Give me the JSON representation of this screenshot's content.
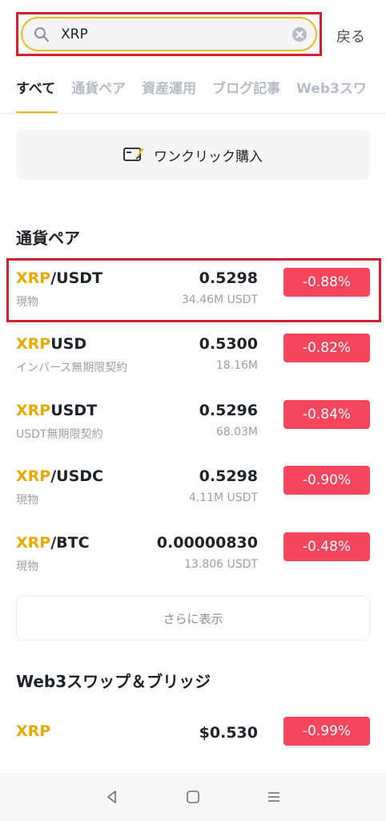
{
  "search": {
    "value": "XRP",
    "back_label": "戻る"
  },
  "tabs": [
    {
      "label": "すべて",
      "active": true
    },
    {
      "label": "通貨ペア"
    },
    {
      "label": "資産運用"
    },
    {
      "label": "ブログ記事"
    },
    {
      "label": "Web3スワ"
    }
  ],
  "oneclick": {
    "label": "ワンクリック購入"
  },
  "sections": {
    "pairs_title": "通貨ペア",
    "web3_title": "Web3スワップ＆ブリッジ"
  },
  "pairs": [
    {
      "base": "XRP",
      "quote": "/USDT",
      "sub": "現物",
      "price": "0.5298",
      "volume": "34.46M USDT",
      "change": "-0.88%"
    },
    {
      "base": "XRP",
      "quote": "USD",
      "sub": "インバース無期限契約",
      "price": "0.5300",
      "volume": "18.16M",
      "change": "-0.82%"
    },
    {
      "base": "XRP",
      "quote": "USDT",
      "sub": "USDT無期限契約",
      "price": "0.5296",
      "volume": "68.03M",
      "change": "-0.84%"
    },
    {
      "base": "XRP",
      "quote": "/USDC",
      "sub": "現物",
      "price": "0.5298",
      "volume": "4.11M USDT",
      "change": "-0.90%"
    },
    {
      "base": "XRP",
      "quote": "/BTC",
      "sub": "現物",
      "price": "0.00000830",
      "volume": "13.806 USDT",
      "change": "-0.48%"
    }
  ],
  "more": {
    "label": "さらに表示"
  },
  "web3": [
    {
      "base": "XRP",
      "price": "$0.530",
      "change": "-0.99%"
    }
  ],
  "colors": {
    "accent": "#f0b90b",
    "negative": "#f6465d",
    "highlight": "#d31f2e"
  },
  "icons": {
    "search": "search-icon",
    "clear": "clear-icon",
    "oneclick": "rocket-card-icon",
    "nav_back": "triangle-back-icon",
    "nav_home": "square-home-icon",
    "nav_menu": "hamburger-menu-icon"
  }
}
